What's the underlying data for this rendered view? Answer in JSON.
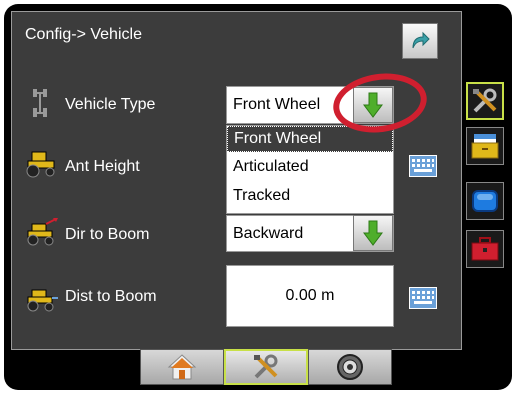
{
  "header": {
    "title": "Config-> Vehicle"
  },
  "rows": {
    "vehicle_type": {
      "label": "Vehicle Type",
      "value": "Front Wheel"
    },
    "ant_height": {
      "label": "Ant Height"
    },
    "dir_to_boom": {
      "label": "Dir to Boom",
      "value": "Backward"
    },
    "dist_to_boom": {
      "label": "Dist to Boom",
      "value": "0.00 m"
    }
  },
  "dropdown": {
    "options": [
      "Front Wheel",
      "Articulated",
      "Tracked"
    ],
    "selected": "Front Wheel"
  },
  "colors": {
    "panel": "#3c3c3c",
    "accent_active": "#c8e048",
    "annotation": "#d01f2f",
    "arrow_green": "#4fae2b"
  },
  "icons": {
    "back": "return-arrow-icon",
    "dropdown": "green-down-arrow-icon",
    "keyboard": "keyboard-icon",
    "side": [
      "tools-icon",
      "files-icon",
      "display-icon",
      "toolbox-icon"
    ],
    "bottom": [
      "home-icon",
      "tools-icon",
      "gauge-icon"
    ]
  }
}
